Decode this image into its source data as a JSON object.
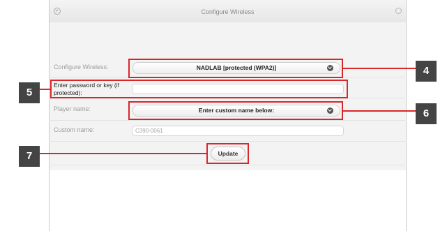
{
  "window": {
    "title": "Configure Wireless"
  },
  "form": {
    "configure_wireless": {
      "label": "Configure Wireless:",
      "value": "NADLAB [protected (WPA2)]"
    },
    "password": {
      "label": "Enter password or key (if protected):",
      "value": ""
    },
    "player_name": {
      "label": "Player name:",
      "value": "Enter custom name below:"
    },
    "custom_name": {
      "label": "Custom name:",
      "placeholder": "C390-0061"
    },
    "update_label": "Update"
  },
  "callouts": [
    "4",
    "5",
    "6",
    "7"
  ],
  "colors": {
    "highlight": "#d9262b",
    "callout_bg": "#444445",
    "panel_bg": "#f3f3f3"
  },
  "icons": {
    "dropdown": "chevron-down-circle-icon",
    "titlebar_left": "chevron-circle-icon",
    "titlebar_right": "circle-icon"
  }
}
